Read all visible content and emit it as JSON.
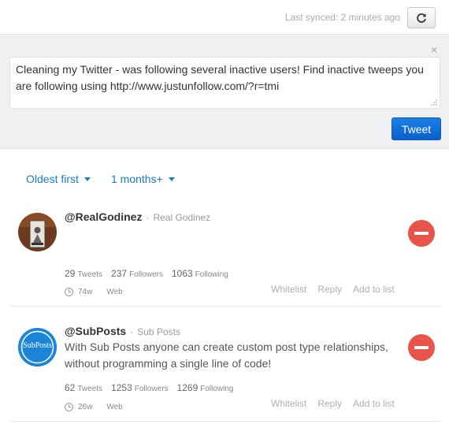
{
  "header": {
    "sync_text": "Last synced: 2 minutes ago",
    "refresh_icon": "refresh-icon"
  },
  "compose": {
    "close_label": "×",
    "tweet_text": "Cleaning my Twitter - was following several inactive users! Find inactive tweeps you are following using http://www.justunfollow.com/?r=tmi",
    "tweet_button": "Tweet"
  },
  "filters": {
    "sort_label": "Oldest first",
    "age_label": "1 months+"
  },
  "users": [
    {
      "handle": "@RealGodinez",
      "separator": "·",
      "name": "Real Godinez",
      "bio": "",
      "tweets": "29",
      "tweets_label": "Tweets",
      "followers": "237",
      "followers_label": "Followers",
      "following": "1063",
      "following_label": "Following",
      "last_tweet": "74w",
      "source": "Web",
      "actions": [
        "Whitelist",
        "Reply",
        "Add to list"
      ]
    },
    {
      "handle": "@SubPosts",
      "separator": "·",
      "name": "Sub Posts",
      "avatar_text": "SubPosts",
      "bio": "With Sub Posts anyone can create custom post type relationships, without programming a single line of code!",
      "tweets": "62",
      "tweets_label": "Tweets",
      "followers": "1253",
      "followers_label": "Followers",
      "following": "1269",
      "following_label": "Following",
      "last_tweet": "26w",
      "source": "Web",
      "actions": [
        "Whitelist",
        "Reply",
        "Add to list"
      ]
    }
  ],
  "colors": {
    "accent": "#1a7ac4",
    "tweet_button": "#0a5fcc",
    "unfollow": "#e8534a",
    "compose_bg": "#eef0f1"
  }
}
